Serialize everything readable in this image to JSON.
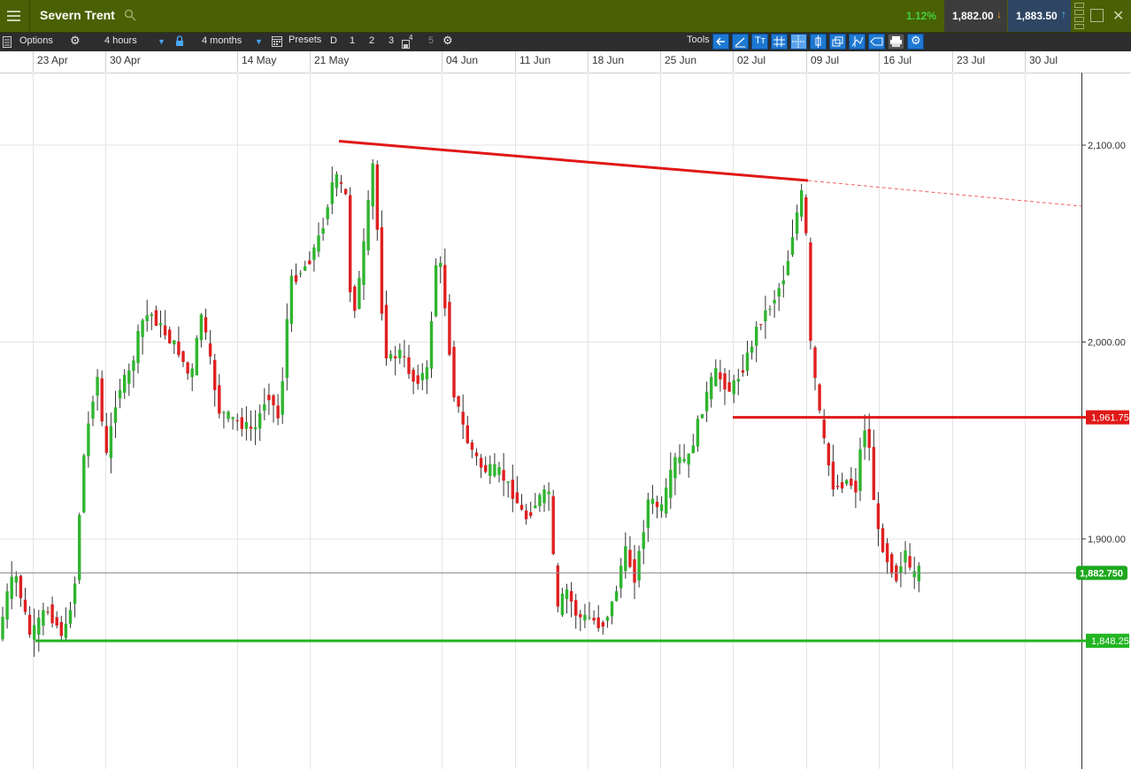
{
  "app": {
    "title": "Severn Trent",
    "change": "1.12%",
    "sell": "1,882.00",
    "buy": "1,883.50",
    "icons": [
      "menu-icon",
      "search-icon",
      "restore-icon",
      "close-icon"
    ]
  },
  "toolbar": {
    "options_label": "Options",
    "interval": "4 hours",
    "range": "4 months",
    "presets_label": "Presets",
    "preset_d": "D",
    "preset_1": "1",
    "preset_2": "2",
    "preset_3": "3",
    "preset_4": "4",
    "preset_5": "5",
    "tools_label": "Tools"
  },
  "chart_data": {
    "type": "candlestick",
    "x_dates": [
      "23 Apr",
      "30 Apr",
      "14 May",
      "21 May",
      "04 Jun",
      "11 Jun",
      "18 Jun",
      "25 Jun",
      "02 Jul",
      "09 Jul",
      "16 Jul",
      "23 Jul",
      "30 Jul"
    ],
    "y_ticks": [
      "2,100.00",
      "2,000.00",
      "1,900.00"
    ],
    "ylim": [
      1790,
      2138
    ],
    "current_price": "1,882.750",
    "current_price_value": 1882.75,
    "resistance_label": "1,961.75",
    "resistance_value": 1961.75,
    "support_label": "1,848.25",
    "support_value": 1848.25,
    "trend_line": {
      "start": [
        "21 May",
        2102
      ],
      "end": [
        "09 Jul",
        2082
      ],
      "extended_to": [
        "30 Jul",
        2069
      ]
    },
    "up_color": "#2fb52f",
    "down_color": "#e02020"
  }
}
